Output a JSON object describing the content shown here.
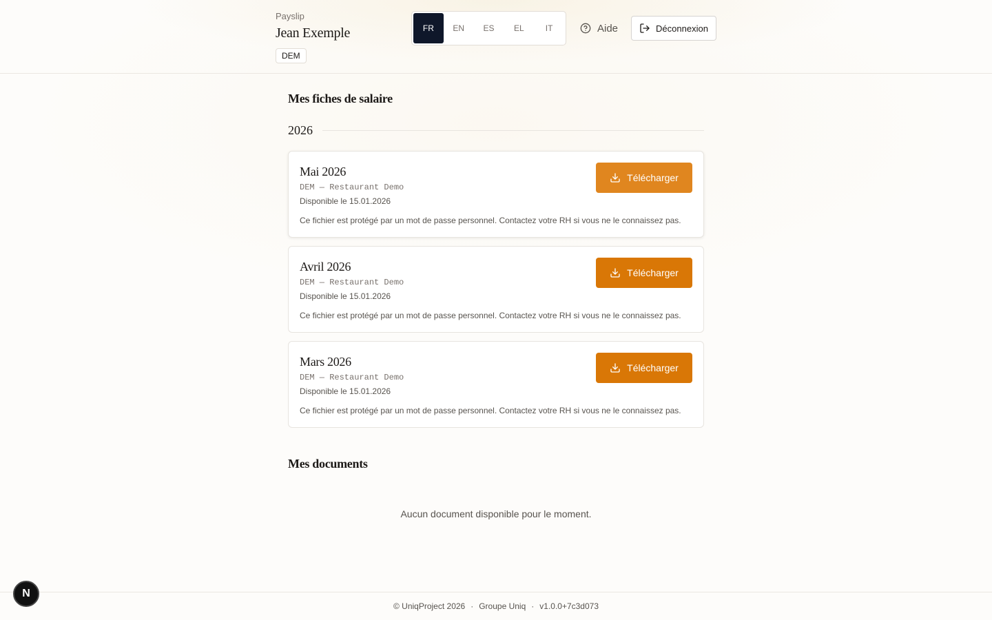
{
  "header": {
    "app_name": "Payslip",
    "user_name": "Jean Exemple",
    "company_badge": "DEM",
    "languages": [
      {
        "code": "FR",
        "active": true
      },
      {
        "code": "EN",
        "active": false
      },
      {
        "code": "ES",
        "active": false
      },
      {
        "code": "EL",
        "active": false
      },
      {
        "code": "IT",
        "active": false
      }
    ],
    "help_label": "Aide",
    "help_icon": "help-circle-icon",
    "logout_label": "Déconnexion",
    "logout_icon": "logout-icon"
  },
  "payslips": {
    "title": "Mes fiches de salaire",
    "year": "2026",
    "items": [
      {
        "title": "Mai 2026",
        "company": "DEM — Restaurant Demo",
        "available": "Disponible le 15.01.2026",
        "note": "Ce fichier est protégé par un mot de passe personnel. Contactez votre RH si vous ne le connaissez pas.",
        "download_label": "Télécharger"
      },
      {
        "title": "Avril 2026",
        "company": "DEM — Restaurant Demo",
        "available": "Disponible le 15.01.2026",
        "note": "Ce fichier est protégé par un mot de passe personnel. Contactez votre RH si vous ne le connaissez pas.",
        "download_label": "Télécharger"
      },
      {
        "title": "Mars 2026",
        "company": "DEM — Restaurant Demo",
        "available": "Disponible le 15.01.2026",
        "note": "Ce fichier est protégé par un mot de passe personnel. Contactez votre RH si vous ne le connaissez pas.",
        "download_label": "Télécharger"
      }
    ]
  },
  "documents": {
    "title": "Mes documents",
    "empty_message": "Aucun document disponible pour le moment."
  },
  "footer": {
    "copyright": "© UniqProject 2026",
    "separator": "·",
    "group": "Groupe Uniq",
    "version": "v1.0.0+7c3d073"
  },
  "dev_badge": {
    "letter": "N"
  },
  "colors": {
    "accent": "#d97706",
    "active_lang_bg": "#0f172a"
  }
}
